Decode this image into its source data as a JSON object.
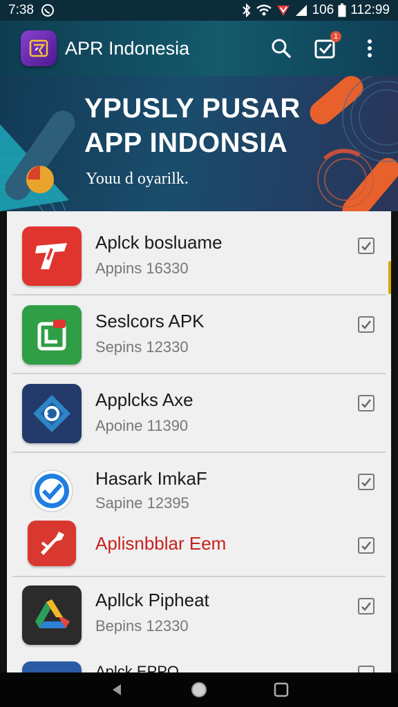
{
  "status_bar": {
    "time": "7:38",
    "left_icon": "whatsapp-icon",
    "battery_level": "106",
    "clock": "112:99"
  },
  "app_bar": {
    "title": "APR Indonesia",
    "notification_count": "1"
  },
  "banner": {
    "title_line1": "YPUSLY PUSAR",
    "title_line2": "APP INDONSIA",
    "subtitle": "Youu d oyarilk."
  },
  "apps": [
    {
      "name": "Aplck bosluame",
      "sub": "Appins 16330",
      "icon": "red-t-logo-icon"
    },
    {
      "name": "Seslcors APK",
      "sub": "Sepins 12330",
      "icon": "green-frame-logo-icon"
    },
    {
      "name": "Applcks Axe",
      "sub": "Apoine 11390",
      "icon": "blue-diamond-logo-icon"
    },
    {
      "name": "Hasark ImkaF",
      "sub": "Sapine 12395",
      "icon": "blue-check-logo-icon"
    },
    {
      "name": "Aplisnbblar Eem",
      "sub": "",
      "icon": "red-wrench-logo-icon"
    },
    {
      "name": "Apllck Pipheat",
      "sub": "Bepins 12330",
      "icon": "drive-triangle-logo-icon"
    }
  ],
  "partial_item": {
    "name": "Aplck EPPO"
  },
  "colors": {
    "app_bar": "#145a6c",
    "accent_red": "#d62b2b",
    "highlight_text": "#c8201e"
  }
}
